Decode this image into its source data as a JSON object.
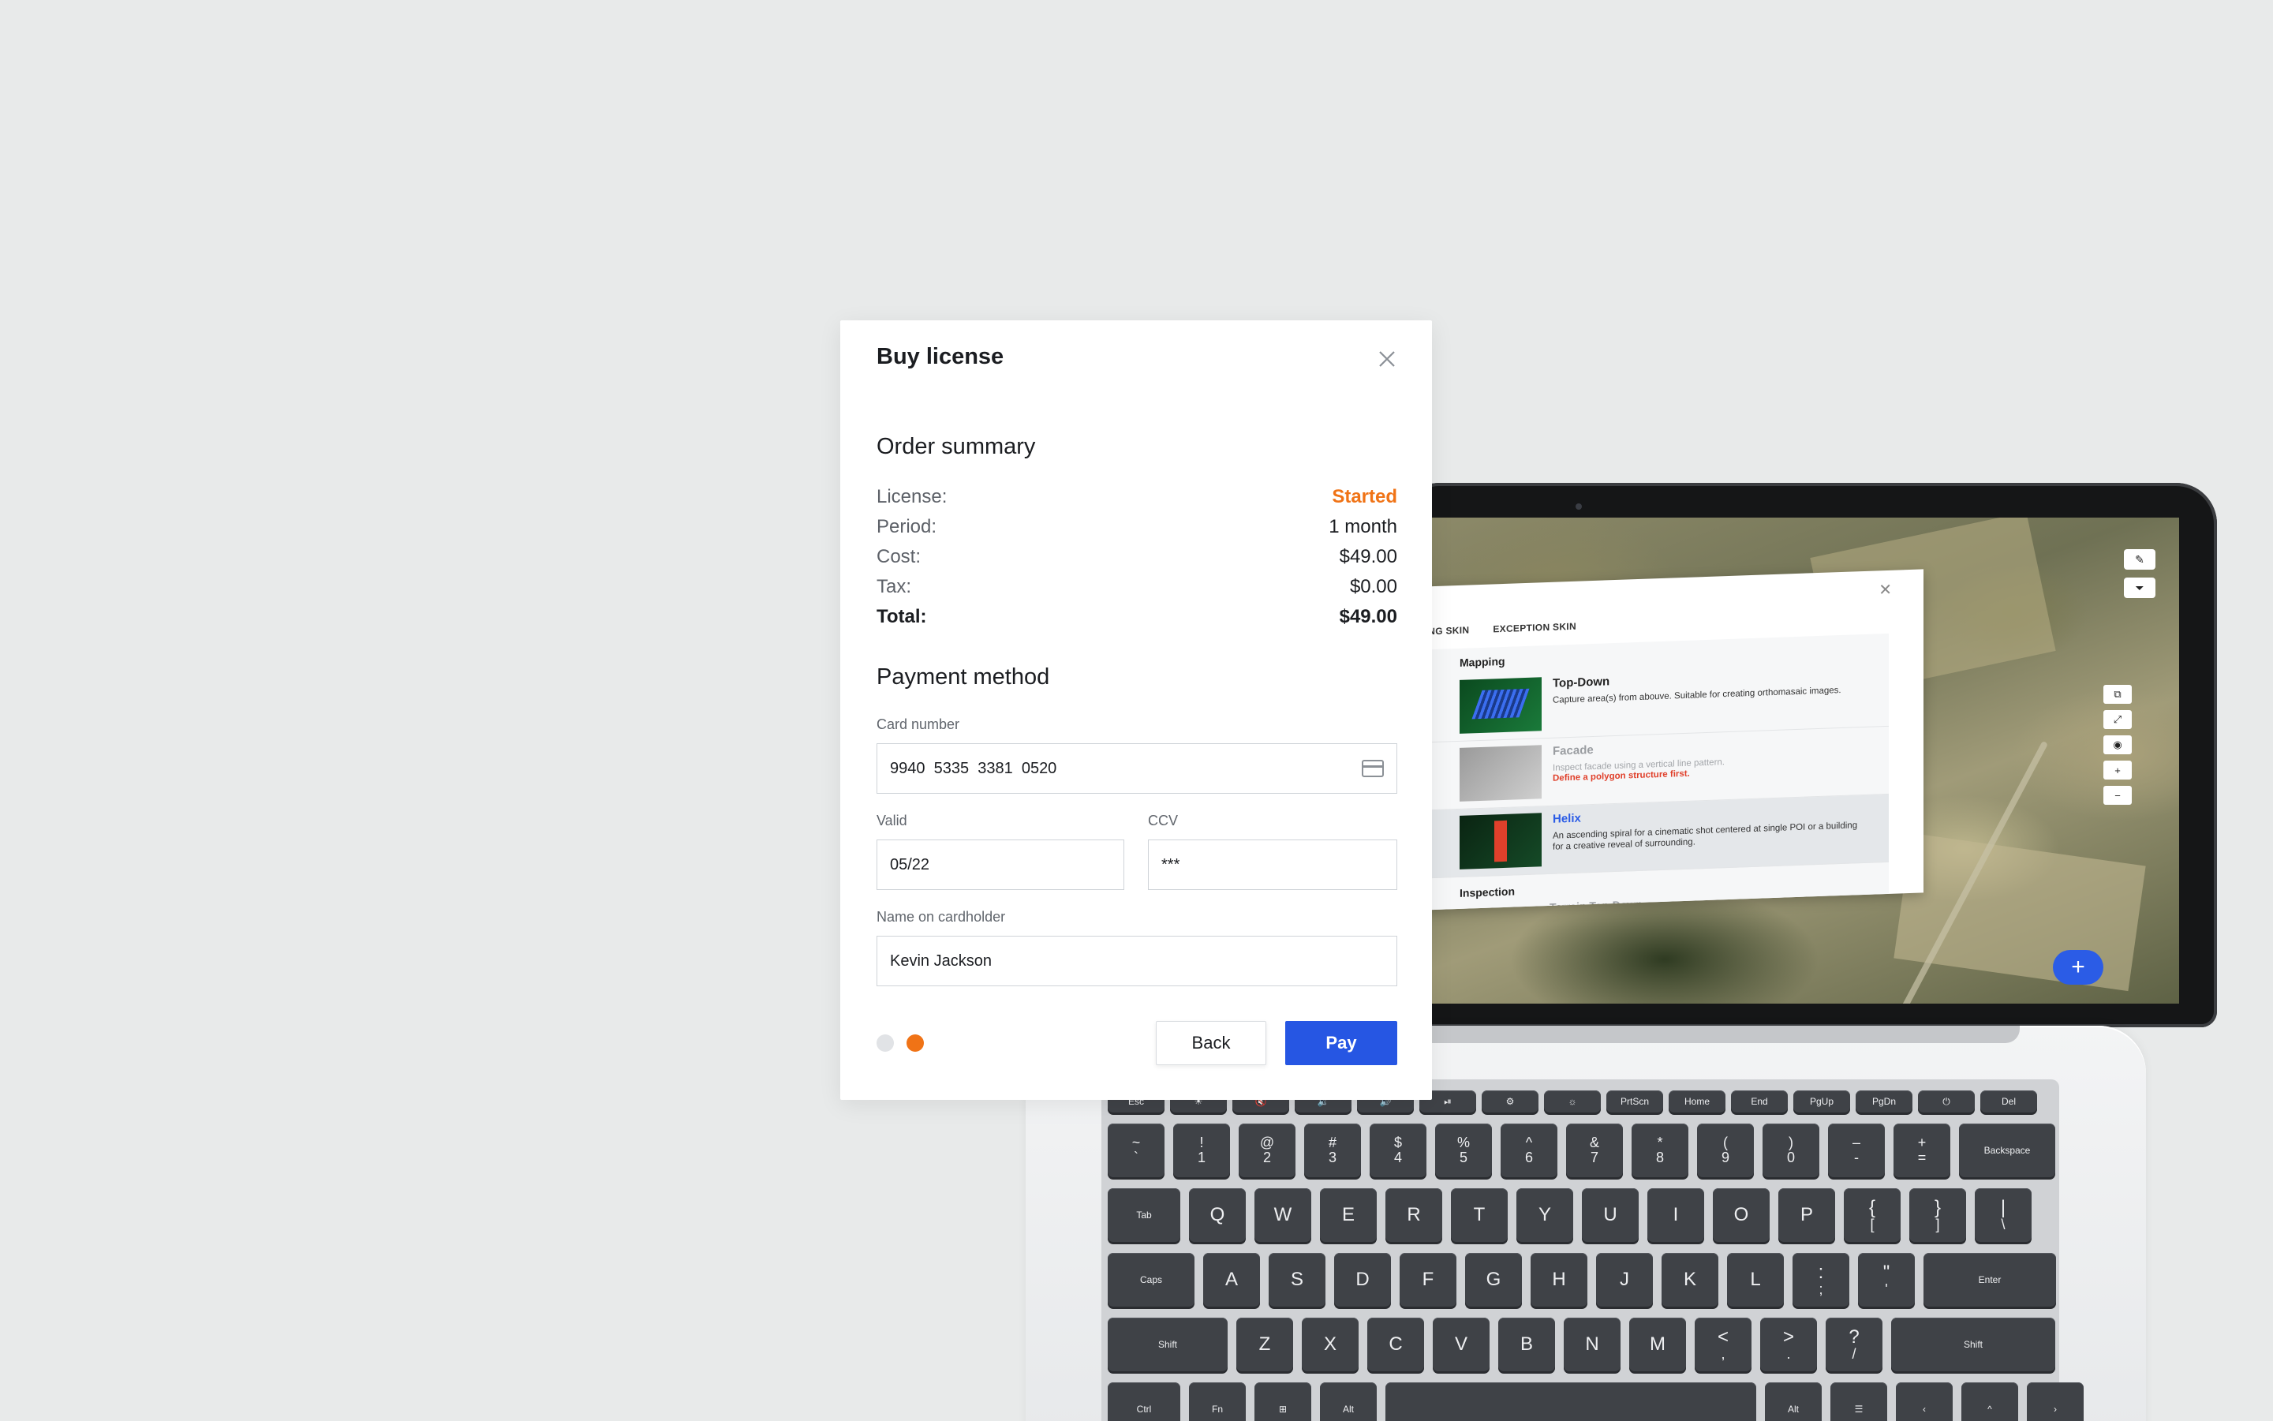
{
  "dialog": {
    "title": "Buy license",
    "order_summary": {
      "title": "Order summary",
      "rows": [
        {
          "label": "License:",
          "value": "Started"
        },
        {
          "label": "Period:",
          "value": "1 month"
        },
        {
          "label": "Cost:",
          "value": "$49.00"
        },
        {
          "label": "Tax:",
          "value": "$0.00"
        },
        {
          "label": "Total:",
          "value": "$49.00"
        }
      ]
    },
    "payment": {
      "title": "Payment method",
      "card_number_label": "Card number",
      "card_number_value": "9940  5335  3381  0520",
      "valid_label": "Valid",
      "valid_value": "05/22",
      "ccv_label": "CCV",
      "ccv_value": "***",
      "name_label": "Name on cardholder",
      "name_value": "Kevin Jackson"
    },
    "steps": {
      "total": 2,
      "current": 2
    },
    "back_label": "Back",
    "pay_label": "Pay",
    "colors": {
      "accent": "#2656e3",
      "license_status": "#f07316",
      "step_active": "#f07316",
      "step_inactive": "#e1e3e6"
    }
  },
  "laptop_screen": {
    "tabs": [
      "PPING SKIN",
      "EXCEPTION SKIN"
    ],
    "group_mapping": "Mapping",
    "items": [
      {
        "title": "Top-Down",
        "desc": "Capture area(s) from abouve. Suitable for creating orthomasaic images.",
        "warning": ""
      },
      {
        "title": "Facade",
        "desc": "Inspect facade using a vertical line pattern.",
        "warning": "Define a polygon structure first."
      },
      {
        "title": "Helix",
        "desc": "An ascending spiral for a cinematic shot centered at single POI or a building for a creative reveal of surrounding.",
        "warning": ""
      }
    ],
    "group_inspection": "Inspection",
    "cut_item": "Terrain Top-Down",
    "fab_label": "+"
  },
  "keyboard": {
    "fn_row": [
      "Esc",
      "☀",
      "🔇",
      "🔉",
      "🔊",
      "⏯",
      "⚙",
      "☼",
      "PrtScn",
      "Home",
      "End",
      "PgUp",
      "PgDn",
      "⏻",
      "Del"
    ],
    "num_row": [
      [
        "~",
        "`"
      ],
      [
        "!",
        "1"
      ],
      [
        "@",
        "2"
      ],
      [
        "#",
        "3"
      ],
      [
        "$",
        "4"
      ],
      [
        "%",
        "5"
      ],
      [
        "^",
        "6"
      ],
      [
        "&",
        "7"
      ],
      [
        "*",
        "8"
      ],
      [
        "(",
        "9"
      ],
      [
        ")",
        "0"
      ],
      [
        "–",
        "-"
      ],
      [
        "+",
        "="
      ],
      [
        "Backspace",
        ""
      ]
    ],
    "tab_row": [
      "Tab",
      "Q",
      "W",
      "E",
      "R",
      "T",
      "Y",
      "U",
      "I",
      "O",
      "P",
      "{ [",
      "} ]",
      "| \\"
    ],
    "caps_row": [
      "Caps",
      "A",
      "S",
      "D",
      "F",
      "G",
      "H",
      "J",
      "K",
      "L",
      ": ;",
      "\" '",
      "Enter"
    ],
    "shift_row": [
      "Shift",
      "Z",
      "X",
      "C",
      "V",
      "B",
      "N",
      "M",
      "< ,",
      "> .",
      "? /",
      "Shift"
    ],
    "bottom_row": [
      "Ctrl",
      "Fn",
      "⊞",
      "Alt",
      "",
      "Alt",
      "☰",
      "‹",
      "^",
      "›"
    ]
  }
}
